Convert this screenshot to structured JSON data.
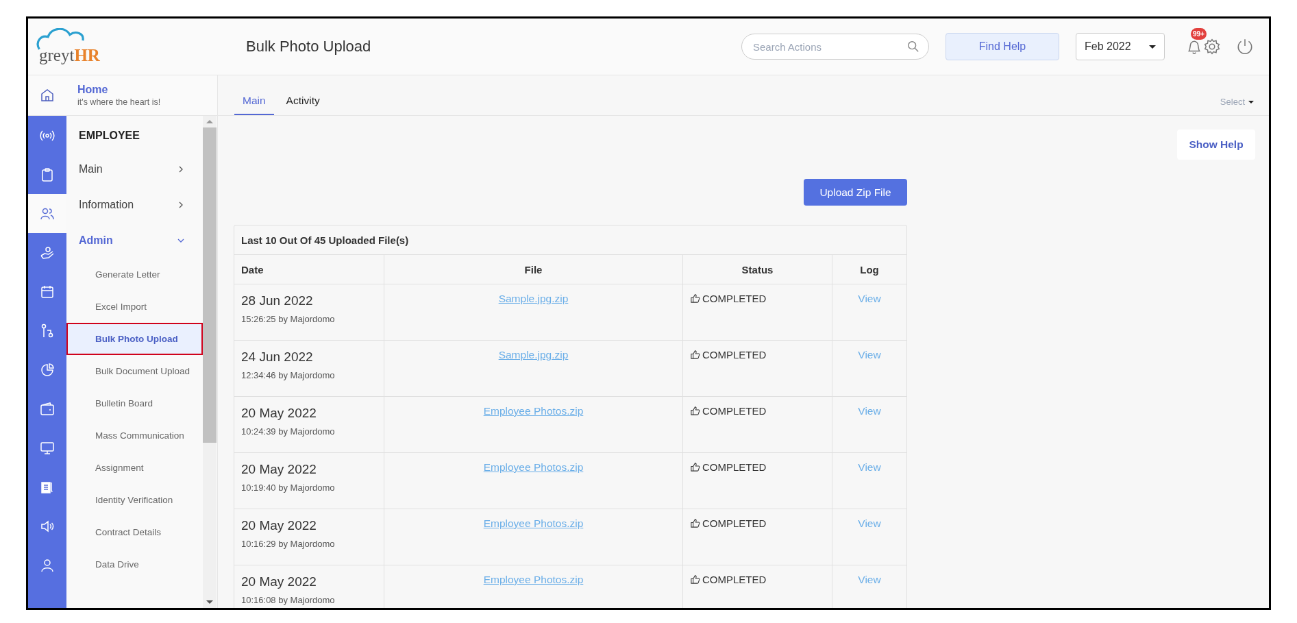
{
  "header": {
    "logo": {
      "part_1": "greyt",
      "part_2": "HR"
    },
    "page_title": "Bulk Photo Upload",
    "search": {
      "placeholder": "Search Actions"
    },
    "find_help": "Find Help",
    "month": "Feb 2022",
    "notification_badge": "99+"
  },
  "home": {
    "title": "Home",
    "subtitle": "it's where the heart is!"
  },
  "rail": [
    {
      "selected": false
    },
    {
      "selected": false
    },
    {
      "selected": true
    },
    {
      "selected": false
    },
    {
      "selected": false
    },
    {
      "selected": false
    },
    {
      "selected": false
    },
    {
      "selected": false
    },
    {
      "selected": false
    },
    {
      "selected": false
    },
    {
      "selected": false
    },
    {
      "selected": false
    }
  ],
  "sidebar": {
    "section": "EMPLOYEE",
    "items": [
      {
        "label": "Main",
        "kind": "group",
        "expanded": false
      },
      {
        "label": "Information",
        "kind": "group",
        "expanded": false
      },
      {
        "label": "Admin",
        "kind": "group",
        "expanded": true
      },
      {
        "label": "Generate Letter",
        "kind": "sub",
        "selected": false
      },
      {
        "label": "Excel Import",
        "kind": "sub",
        "selected": false
      },
      {
        "label": "Bulk Photo Upload",
        "kind": "sub",
        "selected": true
      },
      {
        "label": "Bulk Document Upload",
        "kind": "sub",
        "selected": false
      },
      {
        "label": "Bulletin Board",
        "kind": "sub",
        "selected": false
      },
      {
        "label": "Mass Communication",
        "kind": "sub",
        "selected": false
      },
      {
        "label": "Assignment",
        "kind": "sub",
        "selected": false
      },
      {
        "label": "Identity Verification",
        "kind": "sub",
        "selected": false
      },
      {
        "label": "Contract Details",
        "kind": "sub",
        "selected": false
      },
      {
        "label": "Data Drive",
        "kind": "sub",
        "selected": false
      }
    ]
  },
  "tabs": [
    {
      "label": "Main",
      "selected": true
    },
    {
      "label": "Activity",
      "selected": false
    }
  ],
  "select_dropdown": "Select",
  "show_help": "Show Help",
  "upload_button": "Upload Zip File",
  "table": {
    "caption": "Last 10 Out Of 45 Uploaded File(s)",
    "columns": [
      "Date",
      "File",
      "Status",
      "Log"
    ],
    "rows": [
      {
        "date": "28 Jun 2022",
        "time_by": "15:26:25 by Majordomo",
        "file": "Sample.jpg.zip",
        "status": "COMPLETED",
        "log": "View"
      },
      {
        "date": "24 Jun 2022",
        "time_by": "12:34:46 by Majordomo",
        "file": "Sample.jpg.zip",
        "status": "COMPLETED",
        "log": "View"
      },
      {
        "date": "20 May 2022",
        "time_by": "10:24:39 by Majordomo",
        "file": "Employee Photos.zip",
        "status": "COMPLETED",
        "log": "View"
      },
      {
        "date": "20 May 2022",
        "time_by": "10:19:40 by Majordomo",
        "file": "Employee Photos.zip",
        "status": "COMPLETED",
        "log": "View"
      },
      {
        "date": "20 May 2022",
        "time_by": "10:16:29 by Majordomo",
        "file": "Employee Photos.zip",
        "status": "COMPLETED",
        "log": "View"
      },
      {
        "date": "20 May 2022",
        "time_by": "10:16:08 by Majordomo",
        "file": "Employee Photos.zip",
        "status": "COMPLETED",
        "log": "View"
      }
    ]
  }
}
